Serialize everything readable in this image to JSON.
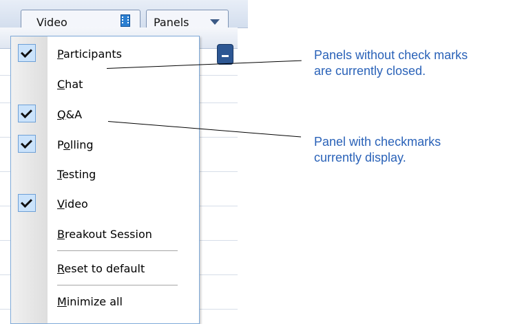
{
  "toolbar": {
    "video_tab_label": "Video",
    "panels_tab_label": "Panels"
  },
  "menu": {
    "items": [
      {
        "mnemonic": "P",
        "rest": "articipants",
        "checked": true
      },
      {
        "mnemonic": "C",
        "rest": "hat",
        "checked": false
      },
      {
        "mnemonic": "Q",
        "rest": "&A",
        "checked": true
      },
      {
        "pre": "P",
        "mnemonic": "o",
        "rest": "lling",
        "checked": true
      },
      {
        "mnemonic": "T",
        "rest": "esting",
        "checked": false
      },
      {
        "mnemonic": "V",
        "rest": "ideo",
        "checked": true
      },
      {
        "mnemonic": "B",
        "rest": "reakout Session",
        "checked": false
      },
      {
        "mnemonic": "R",
        "rest": "eset to default",
        "checked": false
      },
      {
        "mnemonic": "M",
        "rest": "inimize all",
        "checked": false
      }
    ]
  },
  "callouts": {
    "closed_line1": "Panels without check marks",
    "closed_line2": "are currently closed.",
    "open_line1": "Panel with checkmarks",
    "open_line2": "currently display."
  },
  "colors": {
    "callout_text": "#2a62b8",
    "check_fill": "#cbe3fb",
    "menu_border": "#7ea9d8"
  }
}
